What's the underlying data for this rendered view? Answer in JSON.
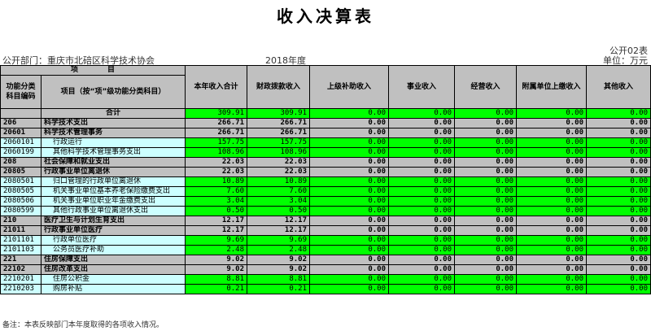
{
  "title": "收入决算表",
  "form_no": "公开02表",
  "department": "公开部门：重庆市北碚区科学技术协会",
  "year": "2018年度",
  "unit": "单位：万元",
  "headers": {
    "project": "项　　　　目",
    "code": "功能分类科目编码",
    "name": "项目（按“项”级功能分类科目）",
    "cols": [
      "本年收入合计",
      "财政拨款收入",
      "上级补助收入",
      "事业收入",
      "经营收入",
      "附属单位上缴收入",
      "其他收入"
    ]
  },
  "total": {
    "label": "合计",
    "values": [
      "309.91",
      "309.91",
      "0.00",
      "0.00",
      "0.00",
      "0.00",
      "0.00"
    ]
  },
  "rows": [
    {
      "code": "206",
      "name": "科学技术支出",
      "level": 1,
      "values": [
        "266.71",
        "266.71",
        "0.00",
        "0.00",
        "0.00",
        "0.00",
        "0.00"
      ]
    },
    {
      "code": "20601",
      "name": "科学技术管理事务",
      "level": 2,
      "values": [
        "266.71",
        "266.71",
        "0.00",
        "0.00",
        "0.00",
        "0.00",
        "0.00"
      ]
    },
    {
      "code": "2060101",
      "name": "行政运行",
      "level": 3,
      "values": [
        "157.75",
        "157.75",
        "0.00",
        "0.00",
        "0.00",
        "0.00",
        "0.00"
      ]
    },
    {
      "code": "2060199",
      "name": "其他科学技术管理事务支出",
      "level": 3,
      "values": [
        "108.96",
        "108.96",
        "0.00",
        "0.00",
        "0.00",
        "0.00",
        "0.00"
      ]
    },
    {
      "code": "208",
      "name": "社会保障和就业支出",
      "level": 1,
      "values": [
        "22.03",
        "22.03",
        "0.00",
        "0.00",
        "0.00",
        "0.00",
        "0.00"
      ]
    },
    {
      "code": "20805",
      "name": "行政事业单位离退休",
      "level": 2,
      "values": [
        "22.03",
        "22.03",
        "0.00",
        "0.00",
        "0.00",
        "0.00",
        "0.00"
      ]
    },
    {
      "code": "2080501",
      "name": "归口管理的行政单位离退休",
      "level": 3,
      "values": [
        "10.89",
        "10.89",
        "0.00",
        "0.00",
        "0.00",
        "0.00",
        "0.00"
      ]
    },
    {
      "code": "2080505",
      "name": "机关事业单位基本养老保险缴费支出",
      "level": 3,
      "values": [
        "7.60",
        "7.60",
        "0.00",
        "0.00",
        "0.00",
        "0.00",
        "0.00"
      ]
    },
    {
      "code": "2080506",
      "name": "机关事业单位职业年金缴费支出",
      "level": 3,
      "values": [
        "3.04",
        "3.04",
        "0.00",
        "0.00",
        "0.00",
        "0.00",
        "0.00"
      ]
    },
    {
      "code": "2080599",
      "name": "其他行政事业单位离退休支出",
      "level": 3,
      "values": [
        "0.50",
        "0.50",
        "0.00",
        "0.00",
        "0.00",
        "0.00",
        "0.00"
      ]
    },
    {
      "code": "210",
      "name": "医疗卫生与计划生育支出",
      "level": 1,
      "values": [
        "12.17",
        "12.17",
        "0.00",
        "0.00",
        "0.00",
        "0.00",
        "0.00"
      ]
    },
    {
      "code": "21011",
      "name": "行政事业单位医疗",
      "level": 2,
      "values": [
        "12.17",
        "12.17",
        "0.00",
        "0.00",
        "0.00",
        "0.00",
        "0.00"
      ]
    },
    {
      "code": "2101101",
      "name": "行政单位医疗",
      "level": 3,
      "values": [
        "9.69",
        "9.69",
        "0.00",
        "0.00",
        "0.00",
        "0.00",
        "0.00"
      ]
    },
    {
      "code": "2101103",
      "name": "公务员医疗补助",
      "level": 3,
      "values": [
        "2.48",
        "2.48",
        "0.00",
        "0.00",
        "0.00",
        "0.00",
        "0.00"
      ]
    },
    {
      "code": "221",
      "name": "住房保障支出",
      "level": 1,
      "values": [
        "9.02",
        "9.02",
        "0.00",
        "0.00",
        "0.00",
        "0.00",
        "0.00"
      ]
    },
    {
      "code": "22102",
      "name": "住房改革支出",
      "level": 2,
      "values": [
        "9.02",
        "9.02",
        "0.00",
        "0.00",
        "0.00",
        "0.00",
        "0.00"
      ]
    },
    {
      "code": "2210201",
      "name": "住房公积金",
      "level": 3,
      "values": [
        "8.81",
        "8.81",
        "0.00",
        "0.00",
        "0.00",
        "0.00",
        "0.00"
      ]
    },
    {
      "code": "2210203",
      "name": "购房补贴",
      "level": 3,
      "values": [
        "0.21",
        "0.21",
        "0.00",
        "0.00",
        "0.00",
        "0.00",
        "0.00"
      ]
    }
  ],
  "note": "备注：本表反映部门本年度取得的各项收入情况。"
}
